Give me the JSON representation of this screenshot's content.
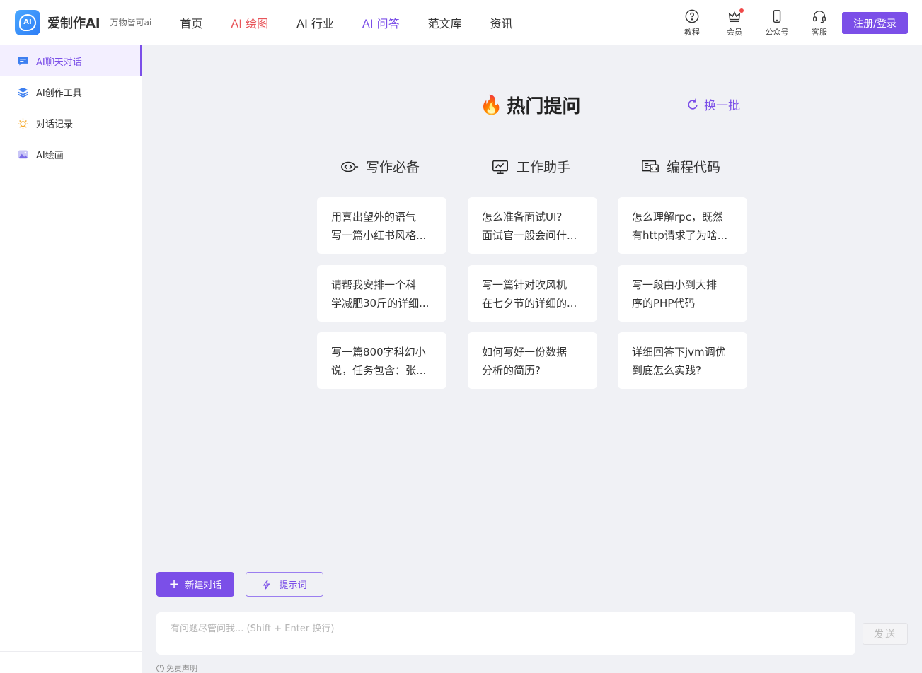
{
  "header": {
    "logo_mark": "AI",
    "app_name": "爱制作AI",
    "slogan": "万物皆可ai",
    "nav": [
      {
        "label": "首页"
      },
      {
        "label": "AI 绘图"
      },
      {
        "label": "AI 行业"
      },
      {
        "label": "AI 问答"
      },
      {
        "label": "范文库"
      },
      {
        "label": "资讯"
      }
    ],
    "tools": [
      {
        "label": "教程",
        "icon": "help-circle-icon"
      },
      {
        "label": "会员",
        "icon": "crown-icon"
      },
      {
        "label": "公众号",
        "icon": "phone-icon"
      },
      {
        "label": "客服",
        "icon": "headset-icon"
      }
    ],
    "login_label": "注册/登录"
  },
  "sidebar": {
    "items": [
      {
        "label": "AI聊天对话",
        "icon": "chat-icon"
      },
      {
        "label": "AI创作工具",
        "icon": "layers-icon"
      },
      {
        "label": "对话记录",
        "icon": "sun-icon"
      },
      {
        "label": "AI绘画",
        "icon": "image-icon"
      }
    ]
  },
  "main": {
    "hot_title": "热门提问",
    "refresh_label": "换一批",
    "columns": [
      {
        "title": "写作必备",
        "icon": "pen-icon",
        "cards": [
          [
            "用喜出望外的语气",
            "写一篇小红书风格..."
          ],
          [
            "请帮我安排一个科",
            "学减肥30斤的详细..."
          ],
          [
            "写一篇800字科幻小",
            "说，任务包含：张..."
          ]
        ]
      },
      {
        "title": "工作助手",
        "icon": "monitor-icon",
        "cards": [
          [
            "怎么准备面试UI?",
            "面试官一般会问什..."
          ],
          [
            "写一篇针对吹风机",
            "在七夕节的详细的..."
          ],
          [
            "如何写好一份数据",
            "分析的简历?"
          ]
        ]
      },
      {
        "title": "编程代码",
        "icon": "code-icon",
        "cards": [
          [
            "怎么理解rpc，既然",
            "有http请求了为啥..."
          ],
          [
            "写一段由小到大排",
            "序的PHP代码"
          ],
          [
            "详细回答下jvm调优",
            "到底怎么实践?"
          ]
        ]
      }
    ],
    "new_chat_label": "新建对话",
    "prompt_label": "提示词",
    "input_placeholder": "有问题尽管问我... (Shift + Enter 换行)",
    "send_label": "发送",
    "disclaimer": "免责声明"
  },
  "colors": {
    "accent": "#7b4fe8",
    "nav_red": "#e8555a",
    "background": "#f0f1f5"
  }
}
